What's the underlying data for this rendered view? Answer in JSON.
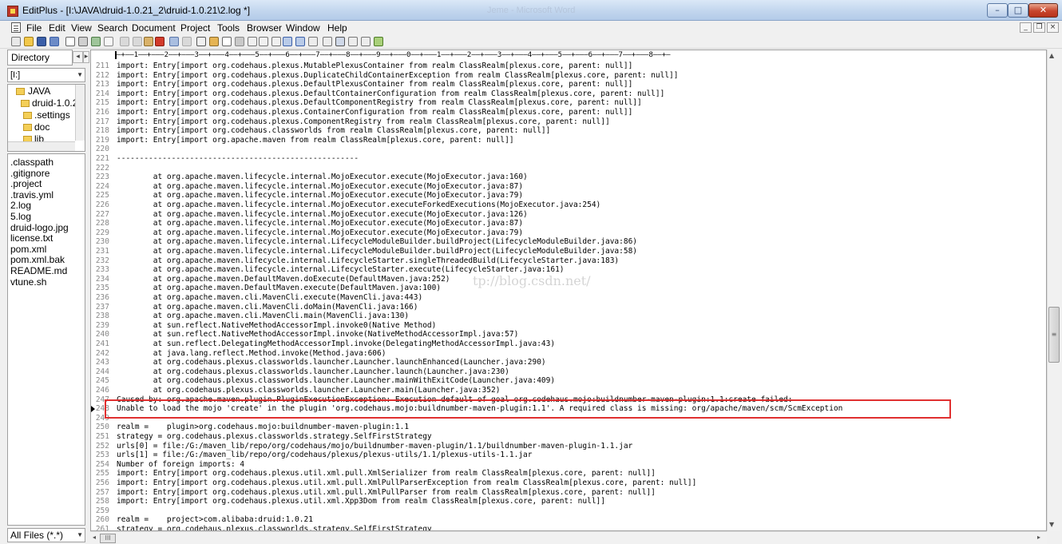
{
  "window": {
    "title": "EditPlus - [I:\\JAVA\\druid-1.0.21_2\\druid-1.0.21\\2.log *]",
    "ghost_title": "Jeme - Microsoft Word",
    "min_glyph": "–",
    "max_glyph": "□",
    "close_glyph": "✕"
  },
  "menu": [
    "File",
    "Edit",
    "View",
    "Search",
    "Document",
    "Project",
    "Tools",
    "Browser",
    "Window",
    "Help"
  ],
  "mdi": {
    "min": "_",
    "restore": "❐",
    "close": "×"
  },
  "sidebar": {
    "tab_label": "Directory",
    "prev_glyph": "◂",
    "next_glyph": "▸",
    "drive": "[I:]",
    "tree": [
      {
        "label": "JAVA"
      },
      {
        "label": "druid-1.0.2"
      },
      {
        "label": ".settings"
      },
      {
        "label": "doc"
      },
      {
        "label": "lib"
      }
    ],
    "files": [
      ".classpath",
      ".gitignore",
      ".project",
      ".travis.yml",
      "2.log",
      "5.log",
      "druid-logo.jpg",
      "license.txt",
      "pom.xml",
      "pom.xml.bak",
      "README.md",
      "vtune.sh"
    ],
    "filter": "All Files (*.*)"
  },
  "editor": {
    "ruler": "—+——1——+———2——+———3——+———4——+———5——+———6——+———7——+———8——+———9——+———0——+———1——+———2——+———3——+———4——+———5——+———6——+———7——+———8——+—",
    "watermark": "tp://blog.csdn.net/",
    "lines": [
      {
        "n": "211",
        "t": "import: Entry[import org.codehaus.plexus.MutablePlexusContainer from realm ClassRealm[plexus.core, parent: null]]"
      },
      {
        "n": "212",
        "t": "import: Entry[import org.codehaus.plexus.DuplicateChildContainerException from realm ClassRealm[plexus.core, parent: null]]"
      },
      {
        "n": "213",
        "t": "import: Entry[import org.codehaus.plexus.DefaultPlexusContainer from realm ClassRealm[plexus.core, parent: null]]"
      },
      {
        "n": "214",
        "t": "import: Entry[import org.codehaus.plexus.DefaultContainerConfiguration from realm ClassRealm[plexus.core, parent: null]]"
      },
      {
        "n": "215",
        "t": "import: Entry[import org.codehaus.plexus.DefaultComponentRegistry from realm ClassRealm[plexus.core, parent: null]]"
      },
      {
        "n": "216",
        "t": "import: Entry[import org.codehaus.plexus.ContainerConfiguration from realm ClassRealm[plexus.core, parent: null]]"
      },
      {
        "n": "217",
        "t": "import: Entry[import org.codehaus.plexus.ComponentRegistry from realm ClassRealm[plexus.core, parent: null]]"
      },
      {
        "n": "218",
        "t": "import: Entry[import org.codehaus.classworlds from realm ClassRealm[plexus.core, parent: null]]"
      },
      {
        "n": "219",
        "t": "import: Entry[import org.apache.maven from realm ClassRealm[plexus.core, parent: null]]"
      },
      {
        "n": "220",
        "t": ""
      },
      {
        "n": "221",
        "t": "-----------------------------------------------------"
      },
      {
        "n": "222",
        "t": ""
      },
      {
        "n": "223",
        "t": "        at org.apache.maven.lifecycle.internal.MojoExecutor.execute(MojoExecutor.java:160)"
      },
      {
        "n": "224",
        "t": "        at org.apache.maven.lifecycle.internal.MojoExecutor.execute(MojoExecutor.java:87)"
      },
      {
        "n": "225",
        "t": "        at org.apache.maven.lifecycle.internal.MojoExecutor.execute(MojoExecutor.java:79)"
      },
      {
        "n": "226",
        "t": "        at org.apache.maven.lifecycle.internal.MojoExecutor.executeForkedExecutions(MojoExecutor.java:254)"
      },
      {
        "n": "227",
        "t": "        at org.apache.maven.lifecycle.internal.MojoExecutor.execute(MojoExecutor.java:126)"
      },
      {
        "n": "228",
        "t": "        at org.apache.maven.lifecycle.internal.MojoExecutor.execute(MojoExecutor.java:87)"
      },
      {
        "n": "229",
        "t": "        at org.apache.maven.lifecycle.internal.MojoExecutor.execute(MojoExecutor.java:79)"
      },
      {
        "n": "230",
        "t": "        at org.apache.maven.lifecycle.internal.LifecycleModuleBuilder.buildProject(LifecycleModuleBuilder.java:86)"
      },
      {
        "n": "231",
        "t": "        at org.apache.maven.lifecycle.internal.LifecycleModuleBuilder.buildProject(LifecycleModuleBuilder.java:58)"
      },
      {
        "n": "232",
        "t": "        at org.apache.maven.lifecycle.internal.LifecycleStarter.singleThreadedBuild(LifecycleStarter.java:183)"
      },
      {
        "n": "233",
        "t": "        at org.apache.maven.lifecycle.internal.LifecycleStarter.execute(LifecycleStarter.java:161)"
      },
      {
        "n": "234",
        "t": "        at org.apache.maven.DefaultMaven.doExecute(DefaultMaven.java:252)"
      },
      {
        "n": "235",
        "t": "        at org.apache.maven.DefaultMaven.execute(DefaultMaven.java:100)"
      },
      {
        "n": "236",
        "t": "        at org.apache.maven.cli.MavenCli.execute(MavenCli.java:443)"
      },
      {
        "n": "237",
        "t": "        at org.apache.maven.cli.MavenCli.doMain(MavenCli.java:166)"
      },
      {
        "n": "238",
        "t": "        at org.apache.maven.cli.MavenCli.main(MavenCli.java:130)"
      },
      {
        "n": "239",
        "t": "        at sun.reflect.NativeMethodAccessorImpl.invoke0(Native Method)"
      },
      {
        "n": "240",
        "t": "        at sun.reflect.NativeMethodAccessorImpl.invoke(NativeMethodAccessorImpl.java:57)"
      },
      {
        "n": "241",
        "t": "        at sun.reflect.DelegatingMethodAccessorImpl.invoke(DelegatingMethodAccessorImpl.java:43)"
      },
      {
        "n": "242",
        "t": "        at java.lang.reflect.Method.invoke(Method.java:606)"
      },
      {
        "n": "243",
        "t": "        at org.codehaus.plexus.classworlds.launcher.Launcher.launchEnhanced(Launcher.java:290)"
      },
      {
        "n": "244",
        "t": "        at org.codehaus.plexus.classworlds.launcher.Launcher.launch(Launcher.java:230)"
      },
      {
        "n": "245",
        "t": "        at org.codehaus.plexus.classworlds.launcher.Launcher.mainWithExitCode(Launcher.java:409)"
      },
      {
        "n": "246",
        "t": "        at org.codehaus.plexus.classworlds.launcher.Launcher.main(Launcher.java:352)"
      },
      {
        "n": "247",
        "t": "Caused by: org.apache.maven.plugin.PluginExecutionException: Execution default of goal org.codehaus.mojo:buildnumber-maven-plugin:1.1:create failed:"
      },
      {
        "n": "248",
        "t": "Unable to load the mojo 'create' in the plugin 'org.codehaus.mojo:buildnumber-maven-plugin:1.1'. A required class is missing: org/apache/maven/scm/ScmException"
      },
      {
        "n": "249",
        "t": "-----------------------------------------------------"
      },
      {
        "n": "250",
        "t": "realm =    plugin>org.codehaus.mojo:buildnumber-maven-plugin:1.1"
      },
      {
        "n": "251",
        "t": "strategy = org.codehaus.plexus.classworlds.strategy.SelfFirstStrategy"
      },
      {
        "n": "252",
        "t": "urls[0] = file:/G:/maven_lib/repo/org/codehaus/mojo/buildnumber-maven-plugin/1.1/buildnumber-maven-plugin-1.1.jar"
      },
      {
        "n": "253",
        "t": "urls[1] = file:/G:/maven_lib/repo/org/codehaus/plexus/plexus-utils/1.1/plexus-utils-1.1.jar"
      },
      {
        "n": "254",
        "t": "Number of foreign imports: 4"
      },
      {
        "n": "255",
        "t": "import: Entry[import org.codehaus.plexus.util.xml.pull.XmlSerializer from realm ClassRealm[plexus.core, parent: null]]"
      },
      {
        "n": "256",
        "t": "import: Entry[import org.codehaus.plexus.util.xml.pull.XmlPullParserException from realm ClassRealm[plexus.core, parent: null]]"
      },
      {
        "n": "257",
        "t": "import: Entry[import org.codehaus.plexus.util.xml.pull.XmlPullParser from realm ClassRealm[plexus.core, parent: null]]"
      },
      {
        "n": "258",
        "t": "import: Entry[import org.codehaus.plexus.util.xml.Xpp3Dom from realm ClassRealm[plexus.core, parent: null]]"
      },
      {
        "n": "259",
        "t": ""
      },
      {
        "n": "260",
        "t": "realm =    project>com.alibaba:druid:1.0.21"
      },
      {
        "n": "261",
        "t": "strategy = org.codehaus.plexus.classworlds.strategy.SelfFirstStrategy"
      }
    ]
  },
  "scroll": {
    "thumb_glyph": "≡",
    "up": "▲",
    "down": "▼",
    "left": "◂",
    "right": "▸",
    "hthumb_glyph": "III"
  },
  "colors": {
    "highlight": "#e03030",
    "title_bar": "#c2d6ee",
    "close_button": "#c7452d"
  }
}
